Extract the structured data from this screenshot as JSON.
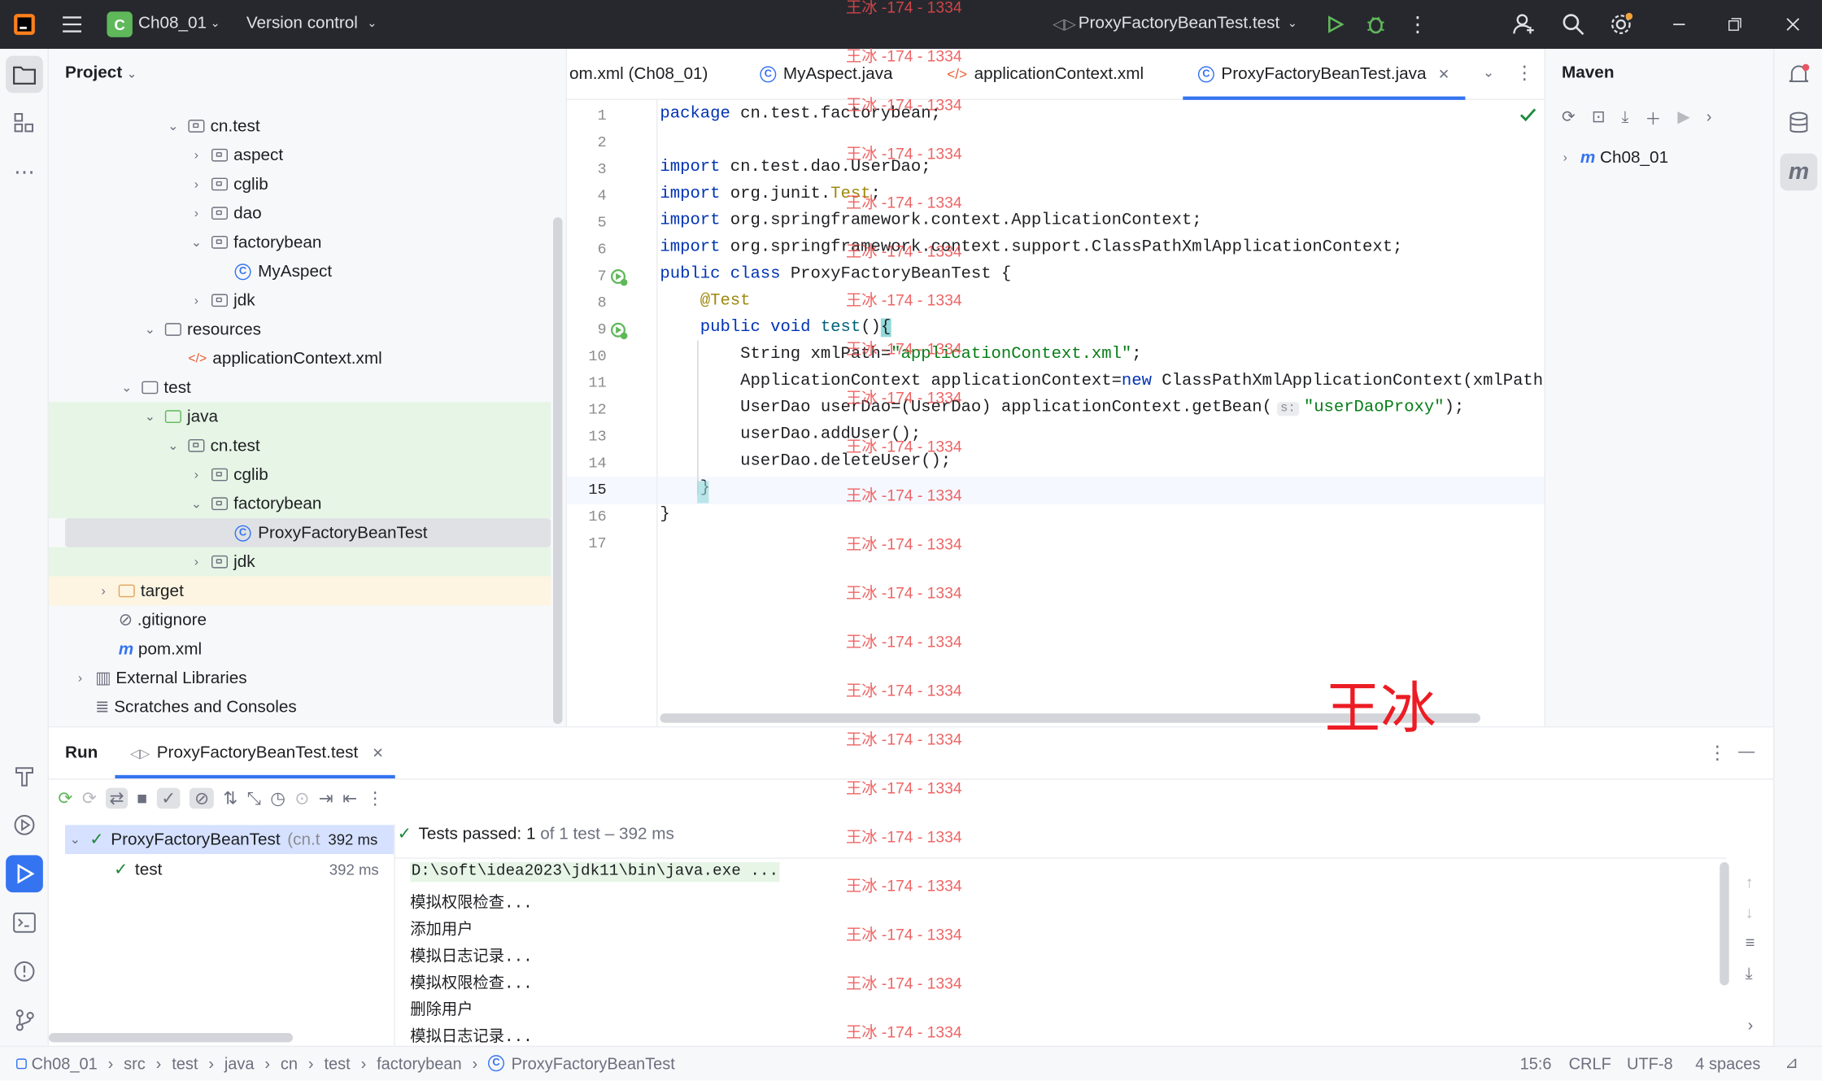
{
  "title_bar": {
    "project": "Ch08_01",
    "project_letter": "C",
    "vcs": "Version control",
    "run_config": "ProxyFactoryBeanTest.test"
  },
  "project_panel": {
    "title": "Project",
    "items": [
      {
        "label": "cn.test",
        "depth": 5,
        "expanded": true,
        "icon": "package-icon"
      },
      {
        "label": "aspect",
        "depth": 6,
        "expanded": false,
        "icon": "package-icon"
      },
      {
        "label": "cglib",
        "depth": 6,
        "expanded": false,
        "icon": "package-icon"
      },
      {
        "label": "dao",
        "depth": 6,
        "expanded": false,
        "icon": "package-icon"
      },
      {
        "label": "factorybean",
        "depth": 6,
        "expanded": true,
        "icon": "package-icon"
      },
      {
        "label": "MyAspect",
        "depth": 7,
        "icon": "class-icon"
      },
      {
        "label": "jdk",
        "depth": 6,
        "expanded": false,
        "icon": "package-icon"
      },
      {
        "label": "resources",
        "depth": 4,
        "expanded": true,
        "icon": "resources-folder-icon"
      },
      {
        "label": "applicationContext.xml",
        "depth": 5,
        "icon": "xml-file-icon"
      },
      {
        "label": "test",
        "depth": 3,
        "expanded": true,
        "icon": "folder-icon"
      },
      {
        "label": "java",
        "depth": 4,
        "expanded": true,
        "icon": "test-folder-icon"
      },
      {
        "label": "cn.test",
        "depth": 5,
        "expanded": true,
        "icon": "package-icon"
      },
      {
        "label": "cglib",
        "depth": 6,
        "expanded": false,
        "icon": "package-icon"
      },
      {
        "label": "factorybean",
        "depth": 6,
        "expanded": true,
        "icon": "package-icon"
      },
      {
        "label": "ProxyFactoryBeanTest",
        "depth": 7,
        "icon": "class-icon",
        "selected": true
      },
      {
        "label": "jdk",
        "depth": 6,
        "expanded": false,
        "icon": "package-icon"
      },
      {
        "label": "target",
        "depth": 2,
        "expanded": false,
        "icon": "excluded-folder-icon"
      },
      {
        "label": ".gitignore",
        "depth": 2,
        "icon": "ignore-file-icon"
      },
      {
        "label": "pom.xml",
        "depth": 2,
        "icon": "maven-file-icon"
      },
      {
        "label": "External Libraries",
        "depth": 1,
        "expanded": false,
        "icon": "library-icon"
      },
      {
        "label": "Scratches and Consoles",
        "depth": 1,
        "icon": "scratches-icon"
      }
    ]
  },
  "editor": {
    "tabs": [
      {
        "label": "om.xml (Ch08_01)",
        "icon": "maven-file-icon"
      },
      {
        "label": "MyAspect.java",
        "icon": "class-icon"
      },
      {
        "label": "applicationContext.xml",
        "icon": "xml-file-icon"
      },
      {
        "label": "ProxyFactoryBeanTest.java",
        "icon": "class-icon",
        "active": true
      }
    ],
    "lines": [
      "1",
      "2",
      "3",
      "4",
      "5",
      "6",
      "7",
      "8",
      "9",
      "10",
      "11",
      "12",
      "13",
      "14",
      "15",
      "16",
      "17"
    ],
    "code": {
      "l1a": "package",
      "l1b": " cn.test.factorybean;",
      "l3a": "import",
      "l3b": " cn.test.dao.UserDao;",
      "l4a": "import",
      "l4b": " org.junit.",
      "l4c": "Test",
      "l4d": ";",
      "l5a": "import",
      "l5b": " org.springframework.context.ApplicationContext;",
      "l6a": "import",
      "l6b": " org.springframework.context.support.ClassPathXmlApplicationContext;",
      "l7a": "public class",
      "l7b": " ProxyFactoryBeanTest {",
      "l8": "    @Test",
      "l9a": "    public void ",
      "l9b": "test",
      "l9c": "()",
      "l9d": "{",
      "l10a": "        String xmlPath=",
      "l10b": "\"applicationContext.xml\"",
      "l10c": ";",
      "l11a": "        ApplicationContext applicationContext=",
      "l11b": "new",
      "l11c": " ClassPathXmlApplicationContext(xmlPath);",
      "l12a": "        UserDao userDao=(UserDao) applicationContext.getBean(",
      "l12h": "s:",
      "l12b": "\"userDaoProxy\"",
      "l12c": ");",
      "l13": "        userDao.addUser();",
      "l14": "        userDao.deleteUser();",
      "l15": "    }",
      "l16": "}"
    }
  },
  "maven": {
    "title": "Maven",
    "project": "Ch08_01"
  },
  "run": {
    "title": "Run",
    "tab": "ProxyFactoryBeanTest.test",
    "tree": [
      {
        "label": "ProxyFactoryBeanTest",
        "pkg": "(cn.t",
        "time": "392 ms"
      },
      {
        "label": "test",
        "time": "392 ms"
      }
    ],
    "summary_a": "Tests passed:",
    "summary_b": "1",
    "summary_c": "of 1 test – 392 ms",
    "output": [
      "D:\\soft\\idea2023\\jdk11\\bin\\java.exe ...",
      "模拟权限检查...",
      "添加用户",
      "模拟日志记录...",
      "模拟权限检查...",
      "删除用户",
      "模拟日志记录..."
    ]
  },
  "statusbar": {
    "crumbs": [
      "Ch08_01",
      "src",
      "test",
      "java",
      "cn",
      "test",
      "factorybean",
      "ProxyFactoryBeanTest"
    ],
    "position": "15:6",
    "line_ending": "CRLF",
    "encoding": "UTF-8",
    "indent": "4 spaces"
  },
  "watermark": {
    "repeat": "王冰 -174 - 1334",
    "big": "王冰"
  },
  "colors": {
    "accent": "#3574f0",
    "pass": "#208a3c",
    "watermark": "#ec4a4a"
  }
}
